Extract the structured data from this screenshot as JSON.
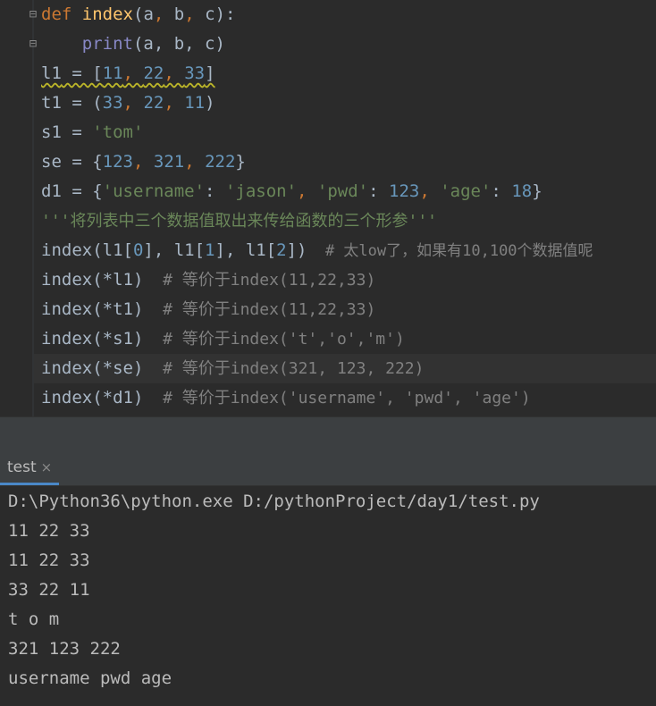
{
  "editor": {
    "line1": {
      "kw": "def",
      "fn": "index",
      "open": "(",
      "a": "a",
      "c1": ", ",
      "b": "b",
      "c2": ", ",
      "c": "c",
      "close": "):"
    },
    "line2": {
      "indent": "    ",
      "builtin": "print",
      "args": "(a, b, c)"
    },
    "line3": {
      "name": "l1",
      "eq": " = [",
      "n1": "11",
      "c1": ", ",
      "n2": "22",
      "c2": ", ",
      "n3": "33",
      "close": "]"
    },
    "line4": {
      "name": "t1",
      "eq": " = (",
      "n1": "33",
      "c1": ", ",
      "n2": "22",
      "c2": ", ",
      "n3": "11",
      "close": ")"
    },
    "line5": {
      "name": "s1",
      "eq": " = ",
      "str": "'tom'"
    },
    "line6": {
      "name": "se",
      "eq": " = {",
      "n1": "123",
      "c1": ", ",
      "n2": "321",
      "c2": ", ",
      "n3": "222",
      "close": "}"
    },
    "line7": {
      "name": "d1",
      "eq": " = {",
      "k1": "'username'",
      "colon1": ": ",
      "v1": "'jason'",
      "c1": ", ",
      "k2": "'pwd'",
      "colon2": ": ",
      "v2": "123",
      "c2": ", ",
      "k3": "'age'",
      "colon3": ": ",
      "v3": "18",
      "close": "}"
    },
    "line8": {
      "docstring": "'''将列表中三个数据值取出来传给函数的三个形参'''"
    },
    "line9": {
      "p1": "index(l1[",
      "i0": "0",
      "p2": "], l1[",
      "i1": "1",
      "p3": "], l1[",
      "i2": "2",
      "p4": "])",
      "comment": "  # 太low了，如果有10,100个数据值呢"
    },
    "line10": {
      "code": "index(*l1)",
      "comment": "  # 等价于index(11,22,33)"
    },
    "line11": {
      "code": "index(*t1)",
      "comment": "  # 等价于index(11,22,33)"
    },
    "line12": {
      "code": "index(*s1)",
      "comment": "  # 等价于index('t','o','m')"
    },
    "line13": {
      "code": "index(*se)",
      "comment": "  # 等价于index(321, 123, 222)"
    },
    "line14": {
      "code": "index(*d1)",
      "comment": "  # 等价于index('username', 'pwd', 'age')"
    }
  },
  "run_panel": {
    "tab_label": "test",
    "tab_close": "×"
  },
  "console": {
    "lines": [
      "D:\\Python36\\python.exe D:/pythonProject/day1/test.py",
      "11 22 33",
      "11 22 33",
      "33 22 11",
      "t o m",
      "321 123 222",
      "username pwd age"
    ]
  },
  "colors": {
    "background": "#2b2b2b",
    "keyword": "#cc7832",
    "function": "#ffc66d",
    "builtin": "#8888c6",
    "number": "#6897bb",
    "string": "#6a8759",
    "comment": "#808080",
    "tab_underline": "#4a88c7"
  },
  "icons": [
    "fold-open-icon",
    "fold-close-icon",
    "close-icon"
  ]
}
